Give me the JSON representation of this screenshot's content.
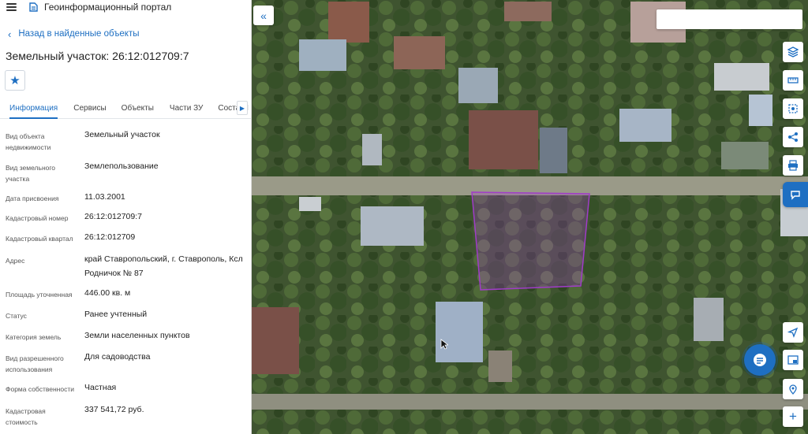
{
  "header": {
    "title": "Геоинформационный портал"
  },
  "nav": {
    "back_label": "Назад в найденные объекты"
  },
  "object": {
    "title": "Земельный участок: 26:12:012709:7"
  },
  "tabs": [
    {
      "label": "Информация",
      "active": true
    },
    {
      "label": "Сервисы",
      "active": false
    },
    {
      "label": "Объекты",
      "active": false
    },
    {
      "label": "Части ЗУ",
      "active": false
    },
    {
      "label": "Состав I",
      "active": false
    }
  ],
  "properties": [
    {
      "label": "Вид объекта недвижимости",
      "value": "Земельный участок"
    },
    {
      "label": "Вид земельного участка",
      "value": "Землепользование"
    },
    {
      "label": "Дата присвоения",
      "value": "11.03.2001"
    },
    {
      "label": "Кадастровый номер",
      "value": "26:12:012709:7"
    },
    {
      "label": "Кадастровый квартал",
      "value": "26:12:012709"
    },
    {
      "label": "Адрес",
      "value": "край Ставропольский, г. Ставрополь, Ксл Родничок № 87"
    },
    {
      "label": "Площадь уточненная",
      "value": "446.00 кв. м"
    },
    {
      "label": "Статус",
      "value": "Ранее учтенный"
    },
    {
      "label": "Категория земель",
      "value": "Земли населенных пунктов"
    },
    {
      "label": "Вид разрешенного использования",
      "value": "Для садоводства"
    },
    {
      "label": "Форма собственности",
      "value": "Частная"
    },
    {
      "label": "Кадастровая стоимость",
      "value": "337 541,72 руб."
    }
  ],
  "map": {
    "layer_select_value": "",
    "tools": [
      "layers-icon",
      "ruler-icon",
      "select-area-icon",
      "share-icon",
      "print-icon",
      "feedback-icon",
      "locate-icon",
      "minimap-icon",
      "location-search-icon",
      "zoom-in-icon"
    ]
  },
  "colors": {
    "accent": "#1e6fc2",
    "parcel": "#a03cc8"
  }
}
